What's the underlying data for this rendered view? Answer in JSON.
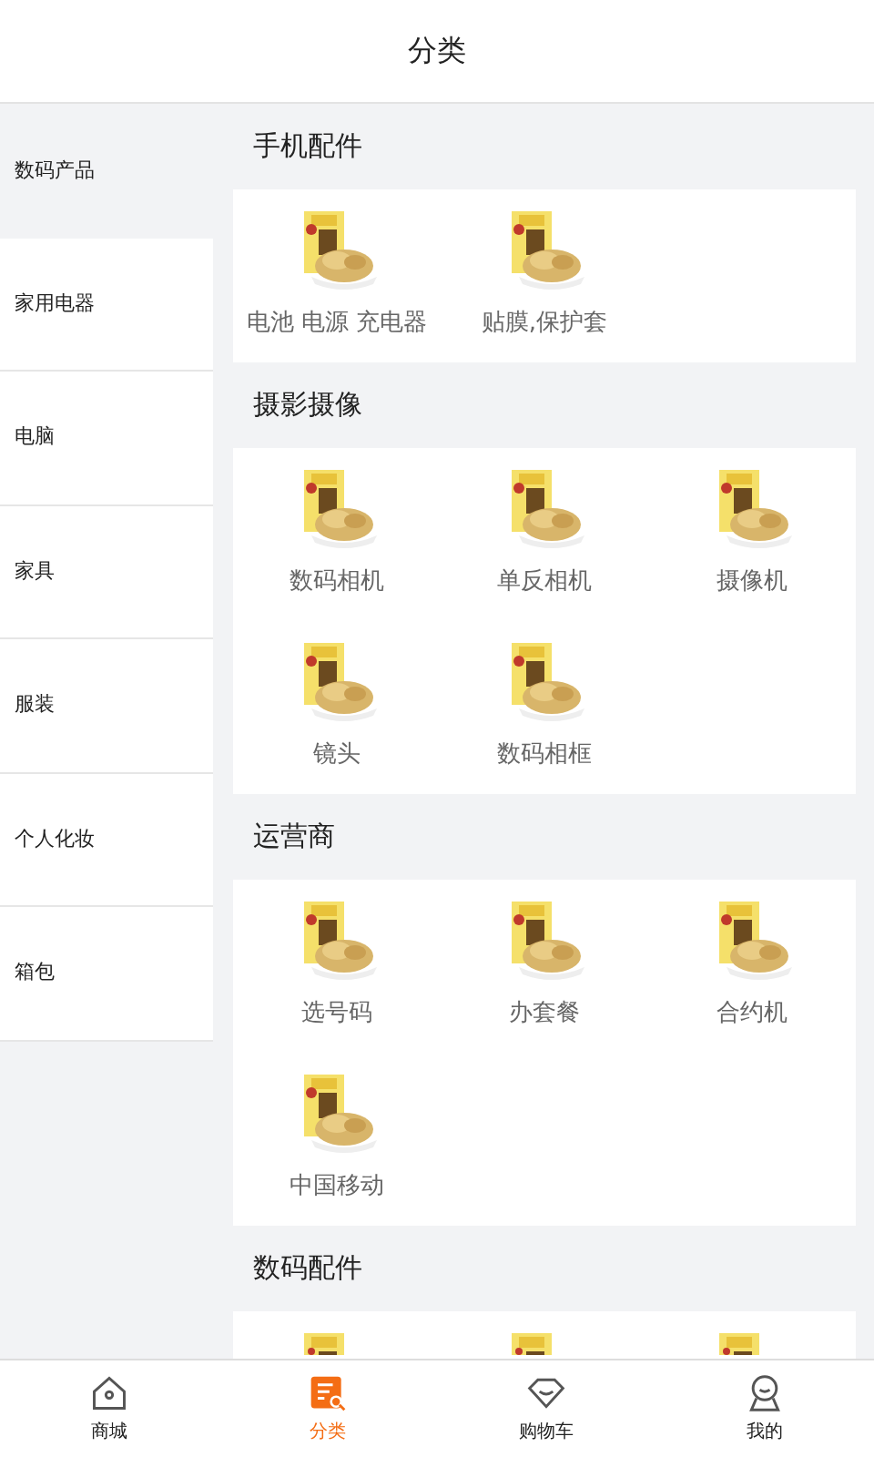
{
  "header": {
    "title": "分类"
  },
  "sidebar": {
    "items": [
      {
        "label": "数码产品",
        "selected": true
      },
      {
        "label": "家用电器",
        "selected": false
      },
      {
        "label": "电脑",
        "selected": false
      },
      {
        "label": "家具",
        "selected": false
      },
      {
        "label": "服装",
        "selected": false
      },
      {
        "label": "个人化妆",
        "selected": false
      },
      {
        "label": "箱包",
        "selected": false
      }
    ]
  },
  "sections": [
    {
      "title": "手机配件",
      "items": [
        {
          "name": "电池 电源 充电器"
        },
        {
          "name": "贴膜,保护套"
        }
      ]
    },
    {
      "title": "摄影摄像",
      "items": [
        {
          "name": "数码相机"
        },
        {
          "name": "单反相机"
        },
        {
          "name": "摄像机"
        },
        {
          "name": "镜头"
        },
        {
          "name": "数码相框"
        }
      ]
    },
    {
      "title": "运营商",
      "items": [
        {
          "name": "选号码"
        },
        {
          "name": "办套餐"
        },
        {
          "name": "合约机"
        },
        {
          "name": "中国移动"
        }
      ]
    },
    {
      "title": "数码配件"
    }
  ],
  "tabbar": [
    {
      "label": "商城",
      "kind": "home",
      "selected": false
    },
    {
      "label": "分类",
      "kind": "category",
      "selected": true
    },
    {
      "label": "购物车",
      "kind": "diamond",
      "selected": false
    },
    {
      "label": "我的",
      "kind": "person",
      "selected": false
    }
  ]
}
